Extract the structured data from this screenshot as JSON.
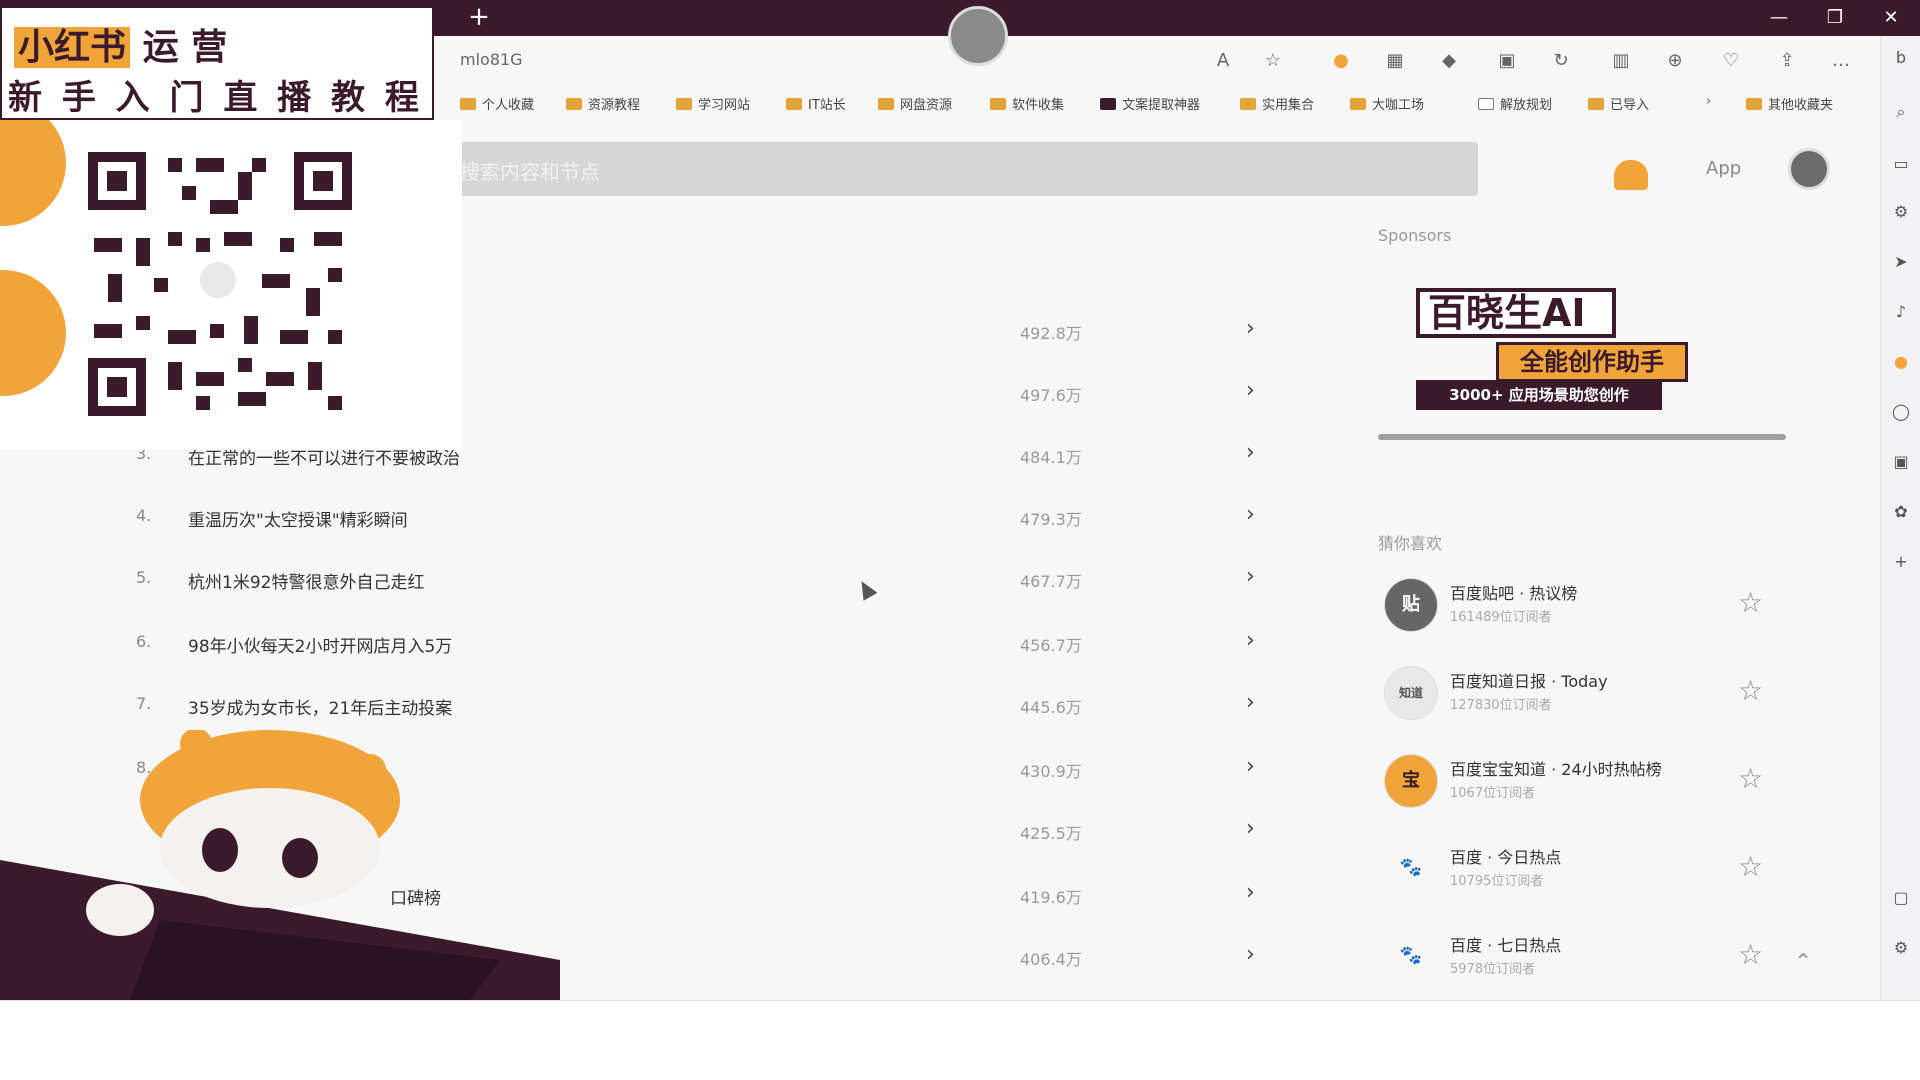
{
  "browser": {
    "url": "mlo81G",
    "toolbar_icons": [
      "read-aloud-icon",
      "favorite-icon",
      "extension-icon",
      "extension-icon",
      "extension-icon",
      "extension-icon",
      "refresh-icon",
      "split-icon",
      "collections-icon",
      "heart-icon",
      "share-icon",
      "more-icon",
      "bing-icon"
    ]
  },
  "bookmarks": [
    {
      "label": "个人收藏",
      "icon": "folder-icon"
    },
    {
      "label": "资源教程",
      "icon": "folder-icon"
    },
    {
      "label": "学习网站",
      "icon": "folder-icon"
    },
    {
      "label": "IT站长",
      "icon": "folder-icon"
    },
    {
      "label": "网盘资源",
      "icon": "folder-icon"
    },
    {
      "label": "软件收集",
      "icon": "folder-icon"
    },
    {
      "label": "文案提取神器",
      "icon": "app-icon"
    },
    {
      "label": "实用集合",
      "icon": "folder-icon"
    },
    {
      "label": "大咖工场",
      "icon": "folder-icon"
    },
    {
      "label": "解放规划",
      "icon": "page-icon"
    },
    {
      "label": "已导入",
      "icon": "folder-icon"
    },
    {
      "label": "其他收藏夹",
      "icon": "folder-icon"
    }
  ],
  "search": {
    "placeholder": "搜索内容和节点"
  },
  "header": {
    "app_label": "App"
  },
  "hot_list": [
    {
      "index": "",
      "title": "",
      "heat": "492.8万"
    },
    {
      "index": "",
      "title": "",
      "heat": "497.6万"
    },
    {
      "index": "3.",
      "title": "在正常的一些不可以进行不要被政治",
      "heat": "484.1万"
    },
    {
      "index": "4.",
      "title": "重温历次\"太空授课\"精彩瞬间",
      "heat": "479.3万"
    },
    {
      "index": "5.",
      "title": "杭州1米92特警很意外自己走红",
      "heat": "467.7万"
    },
    {
      "index": "6.",
      "title": "98年小伙每天2小时开网店月入5万",
      "heat": "456.7万"
    },
    {
      "index": "7.",
      "title": "35岁成为女市长，21年后主动投案",
      "heat": "445.6万"
    },
    {
      "index": "8.",
      "title": "",
      "heat": "430.9万"
    },
    {
      "index": "",
      "title": "",
      "heat": "425.5万"
    },
    {
      "index": "",
      "title": "口碑榜",
      "heat": "419.6万"
    },
    {
      "index": "",
      "title": "",
      "heat": "406.4万"
    }
  ],
  "sponsors": {
    "label": "Sponsors",
    "ad": {
      "brand": "百晓生AI",
      "tagline": "全能创作助手",
      "strip": "3000+ 应用场景助您创作"
    }
  },
  "guess": {
    "label": "猜你喜欢",
    "items": [
      {
        "name": "百度贴吧 · 热议榜",
        "subscribers": "161489位订阅者",
        "avatar_text": "贴"
      },
      {
        "name": "百度知道日报 · Today",
        "subscribers": "127830位订阅者",
        "avatar_text": "知道"
      },
      {
        "name": "百度宝宝知道 · 24小时热帖榜",
        "subscribers": "1067位订阅者",
        "avatar_text": "宝"
      },
      {
        "name": "百度 · 今日热点",
        "subscribers": "10795位订阅者",
        "avatar_text": "🐾"
      },
      {
        "name": "百度 · 七日热点",
        "subscribers": "5978位订阅者",
        "avatar_text": "🐾"
      }
    ]
  },
  "promo": {
    "brand": "小红书",
    "brand_suffix": "运 营",
    "subtitle": "新 手 入 门 直 播 教 程"
  },
  "colors": {
    "accent": "#3b1a2c",
    "orange": "#f0a43a"
  }
}
